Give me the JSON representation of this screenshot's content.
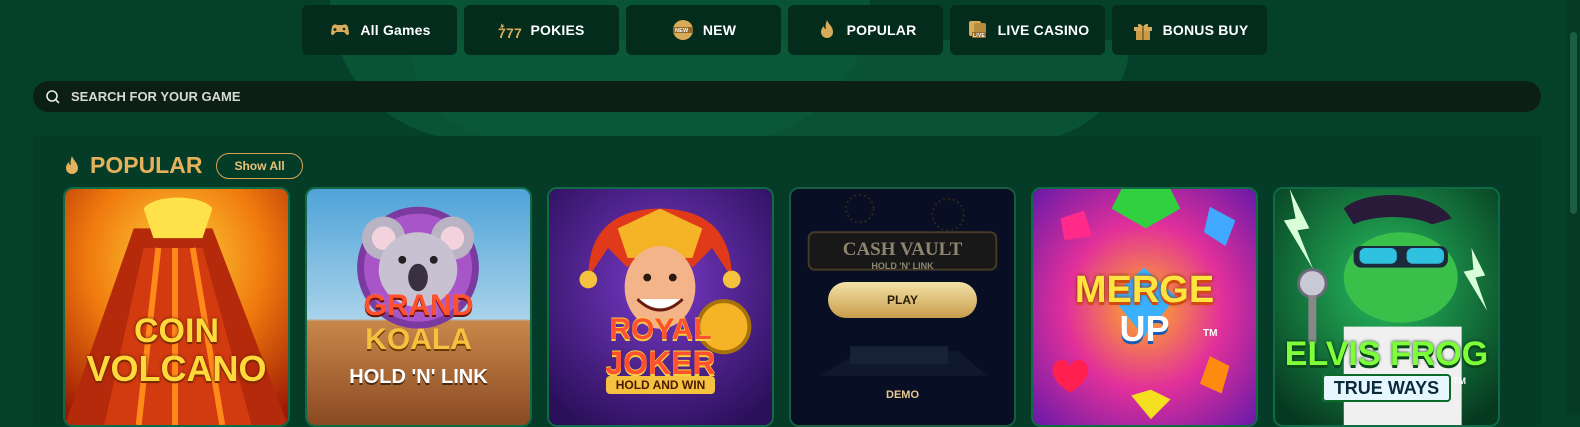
{
  "tabs": [
    {
      "label": "All Games",
      "icon": "gamepad-icon"
    },
    {
      "label": "POKIES",
      "icon": "slot-777-icon"
    },
    {
      "label": "NEW",
      "icon": "new-badge-icon"
    },
    {
      "label": "POPULAR",
      "icon": "flame-icon"
    },
    {
      "label": "LIVE CASINO",
      "icon": "live-cards-icon"
    },
    {
      "label": "BONUS BUY",
      "icon": "gift-icon"
    }
  ],
  "search": {
    "placeholder": "SEARCH FOR YOUR GAME",
    "icon": "search-icon"
  },
  "section": {
    "title": "POPULAR",
    "icon": "flame-icon",
    "show_all": "Show All"
  },
  "games": [
    {
      "logo_line1": "COIN",
      "logo_line2": "VOLCANO"
    },
    {
      "logo_line1": "GRAND",
      "logo_line2": "KOALA",
      "logo_line3": "HOLD 'N' LINK"
    },
    {
      "logo_line1": "ROYAL",
      "logo_line2": "JOKER",
      "logo_line3": "HOLD AND WIN"
    },
    {
      "logo_line1": "CASH VAULT",
      "logo_line2": "HOLD 'N' LINK",
      "play_label": "PLAY",
      "demo_label": "DEMO"
    },
    {
      "logo_line1": "MERGE",
      "logo_line2": "UP",
      "tm": "TM"
    },
    {
      "logo_line1": "ELVIS FROG",
      "logo_line2": "TRUE WAYS",
      "tm": "TM"
    }
  ],
  "colors": {
    "accent_gold": "#e4b25d",
    "page_bg": "#04402a",
    "tab_bg": "#032c1d"
  }
}
